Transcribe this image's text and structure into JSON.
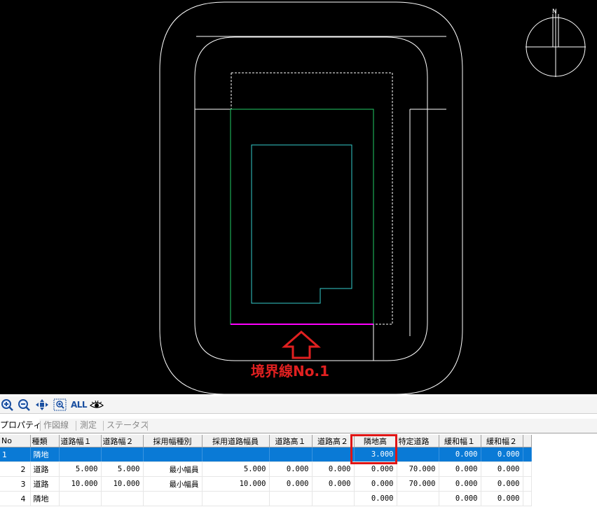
{
  "canvas": {
    "annotation_label": "境界線No.1",
    "colors": {
      "background": "#000000",
      "outline": "#ffffff",
      "site": "#00cc66",
      "building": "#33cccc",
      "boundary": "#ff00ff",
      "annotation": "#e02020"
    },
    "compass_label": "N"
  },
  "toolbar": {
    "buttons": [
      {
        "name": "zoom-in-icon"
      },
      {
        "name": "zoom-out-icon"
      },
      {
        "name": "pan-icon"
      },
      {
        "name": "zoom-window-icon"
      },
      {
        "name": "show-all-button",
        "label": "ALL"
      },
      {
        "name": "eye-icon"
      }
    ]
  },
  "tabs": [
    {
      "label": "プロパティ",
      "active": true
    },
    {
      "label": "作図線",
      "active": false
    },
    {
      "label": "測定",
      "active": false
    },
    {
      "label": "ステータス",
      "active": false
    }
  ],
  "grid": {
    "columns": [
      "No",
      "種類",
      "道路幅１",
      "道路幅２",
      "採用幅種別",
      "採用道路幅員",
      "道路高１",
      "道路高２",
      "隣地高",
      "特定道路",
      "緩和幅１",
      "緩和幅２"
    ],
    "rows": [
      {
        "no": "1",
        "type": "隣地",
        "w1": "",
        "w2": "",
        "kind": "",
        "adopted": "",
        "h1": "",
        "h2": "",
        "adj_h": "3.000",
        "special": "",
        "r1": "0.000",
        "r2": "0.000",
        "selected": true
      },
      {
        "no": "2",
        "type": "道路",
        "w1": "5.000",
        "w2": "5.000",
        "kind": "最小幅員",
        "adopted": "5.000",
        "h1": "0.000",
        "h2": "0.000",
        "adj_h": "0.000",
        "special": "70.000",
        "r1": "0.000",
        "r2": "0.000",
        "selected": false
      },
      {
        "no": "3",
        "type": "道路",
        "w1": "10.000",
        "w2": "10.000",
        "kind": "最小幅員",
        "adopted": "10.000",
        "h1": "0.000",
        "h2": "0.000",
        "adj_h": "0.000",
        "special": "70.000",
        "r1": "0.000",
        "r2": "0.000",
        "selected": false
      },
      {
        "no": "4",
        "type": "隣地",
        "w1": "",
        "w2": "",
        "kind": "",
        "adopted": "",
        "h1": "",
        "h2": "",
        "adj_h": "0.000",
        "special": "",
        "r1": "0.000",
        "r2": "0.000",
        "selected": false
      }
    ]
  }
}
